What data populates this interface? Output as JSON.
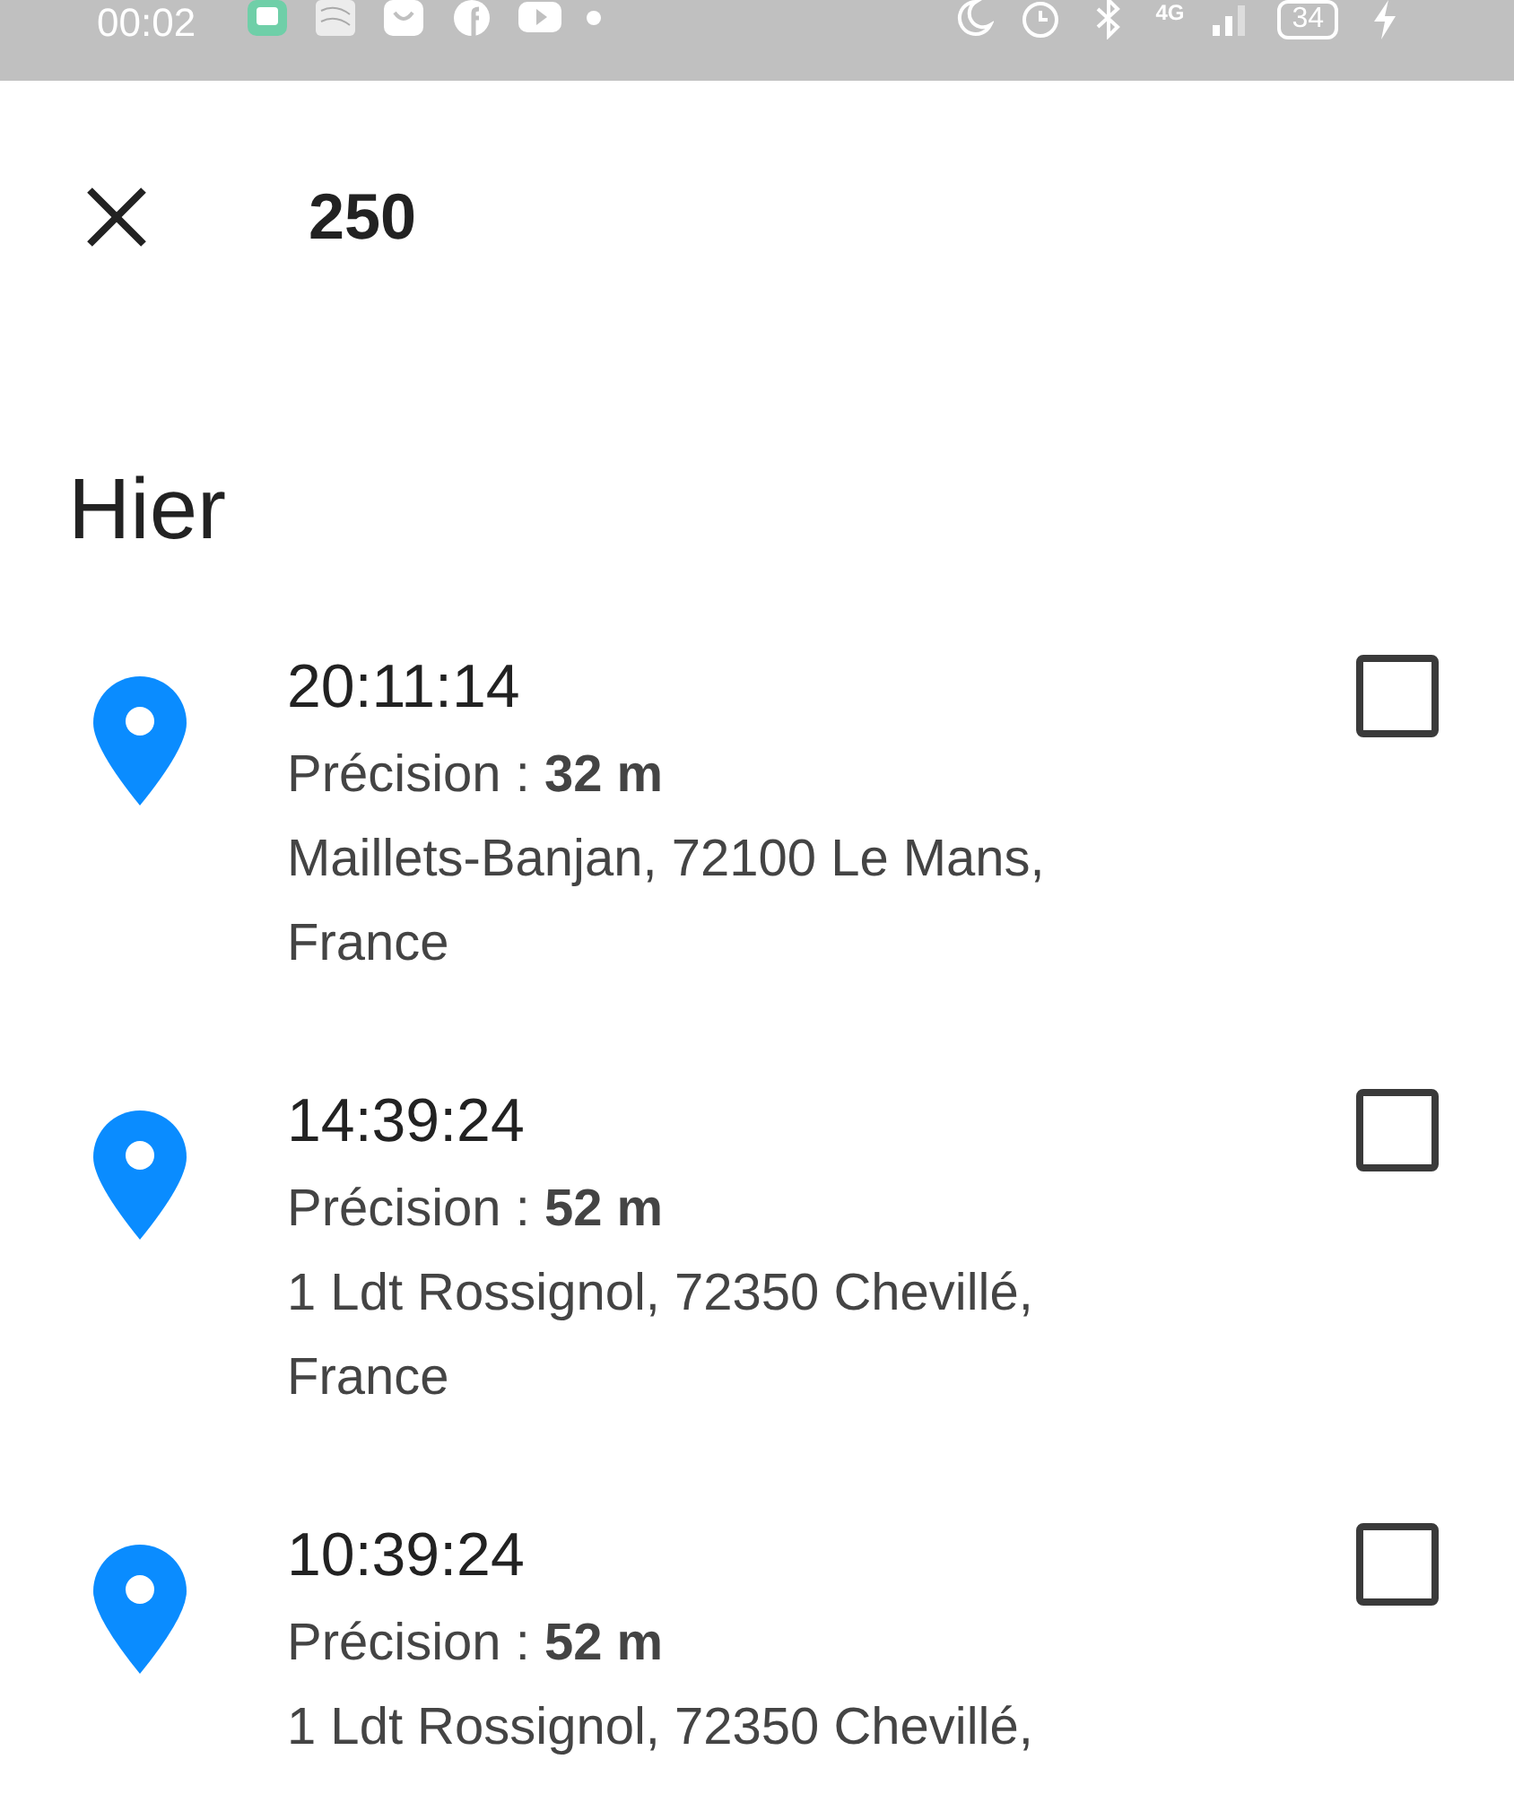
{
  "status_bar": {
    "time": "00:02",
    "network": "4G",
    "battery": "34"
  },
  "header": {
    "title": "250"
  },
  "section": "Hier",
  "entries": [
    {
      "time": "20:11:14",
      "precision": "Précision : **32 m**",
      "address": "Maillets-Banjan, 72100 Le Mans, France",
      "checked": false
    },
    {
      "time": "14:39:24",
      "precision": "Précision : **52 m**",
      "address": "1 Ldt Rossignol, 72350 Chevillé, France",
      "checked": false
    },
    {
      "time": "10:39:24",
      "precision": "Précision : **52 m**",
      "address": "1 Ldt Rossignol, 72350 Chevillé,",
      "checked": false
    }
  ]
}
